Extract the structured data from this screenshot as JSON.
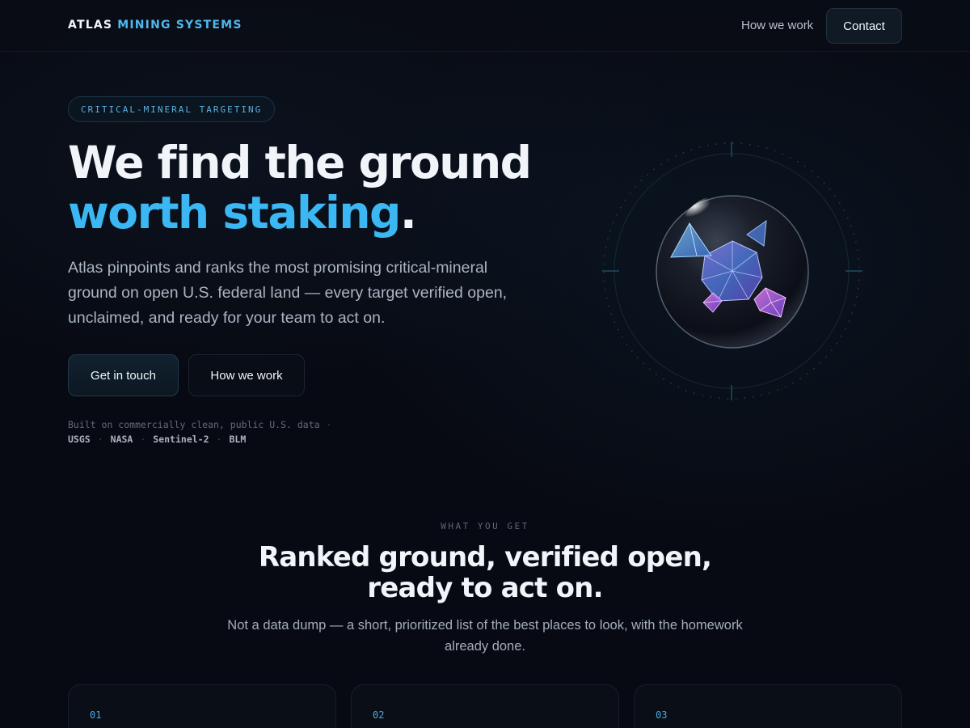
{
  "header": {
    "brand_part1": "ATLAS",
    "brand_part2": "MINING SYSTEMS",
    "nav_link": "How we work",
    "contact_label": "Contact"
  },
  "hero": {
    "pill": "CRITICAL-MINERAL TARGETING",
    "headline_line1": "We find the ground",
    "headline_accent": "worth staking",
    "headline_period": ".",
    "lede": "Atlas pinpoints and ranks the most promising critical-mineral ground on open U.S. federal land — every target verified open, unclaimed, and ready for your team to act on.",
    "primary_cta": "Get in touch",
    "secondary_cta": "How we work",
    "built_on": "Built on commercially clean, public U.S. data",
    "sources": [
      "USGS",
      "NASA",
      "Sentinel-2",
      "BLM"
    ],
    "separator": "·"
  },
  "section": {
    "eyebrow": "WHAT YOU GET",
    "title_line1": "Ranked ground, verified open,",
    "title_line2": "ready to act on.",
    "subtitle": "Not a data dump — a short, prioritized list of the best places to look, with the homework already done.",
    "cards": [
      {
        "num": "01"
      },
      {
        "num": "02"
      },
      {
        "num": "03"
      }
    ]
  },
  "colors": {
    "background": "#070a12",
    "accent": "#3bb8f3",
    "crystal": "#7b6cf0",
    "crystal_pink": "#c05ad8"
  },
  "icons": {
    "orb": "mineral-crystal-orb-icon"
  }
}
